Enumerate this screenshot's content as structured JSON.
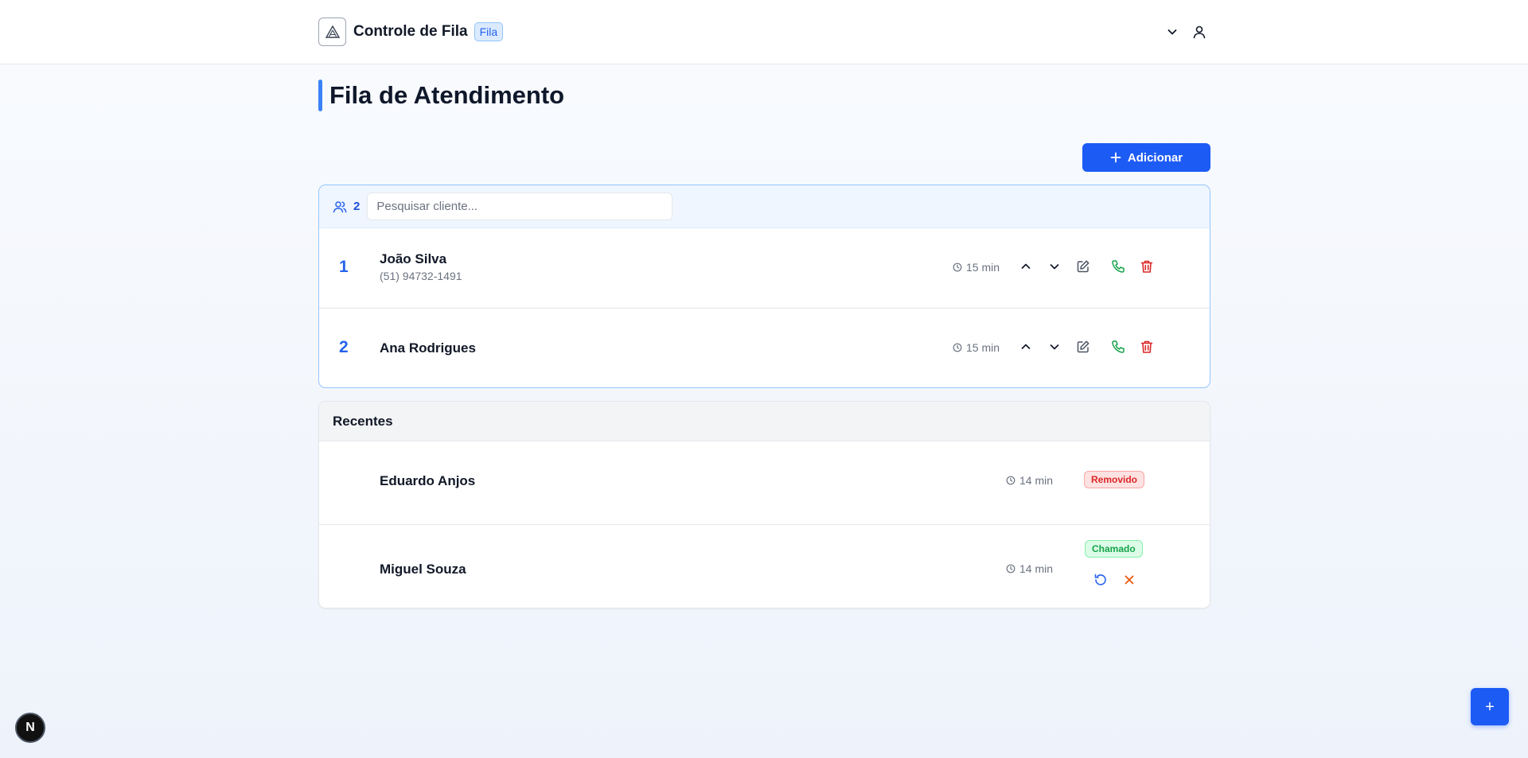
{
  "header": {
    "title": "Controle de Fila",
    "badge": "Fila"
  },
  "page": {
    "title": "Fila de Atendimento",
    "add_label": "Adicionar"
  },
  "queue": {
    "count": "2",
    "search_placeholder": "Pesquisar cliente...",
    "items": [
      {
        "position": "1",
        "name": "João Silva",
        "phone": "(51) 94732-1491",
        "wait": "15 min"
      },
      {
        "position": "2",
        "name": "Ana Rodrigues",
        "wait": "15 min"
      }
    ]
  },
  "recent": {
    "title": "Recentes",
    "items": [
      {
        "name": "Eduardo Anjos",
        "wait": "14 min",
        "status": "Removido"
      },
      {
        "name": "Miguel Souza",
        "wait": "14 min",
        "status": "Chamado"
      }
    ]
  },
  "fab": {
    "label": "+"
  },
  "dev_badge": {
    "label": "N"
  },
  "colors": {
    "primary": "#1d5bf5",
    "accent": "#3b82f6",
    "success": "#16a34a",
    "danger": "#dc2626",
    "warning": "#ea580c"
  }
}
